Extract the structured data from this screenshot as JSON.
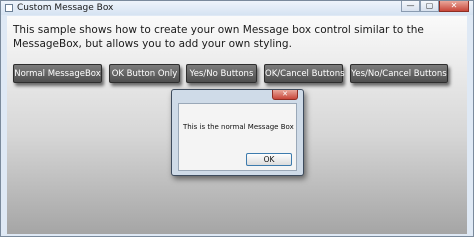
{
  "window": {
    "title": "Custom Message Box",
    "minimize_glyph": "—",
    "maximize_glyph": "▢",
    "close_glyph": "✕"
  },
  "description": "This sample shows how to create your own Message box control similar to the MessageBox, but allows you to add your own styling.",
  "buttons": [
    {
      "label": "Normal MessageBox"
    },
    {
      "label": "OK Button Only"
    },
    {
      "label": "Yes/No Buttons"
    },
    {
      "label": "OK/Cancel Buttons"
    },
    {
      "label": "Yes/No/Cancel Buttons"
    }
  ],
  "dialog": {
    "message": "This is the normal Message Box",
    "ok_label": "OK",
    "close_glyph": "✕"
  },
  "icons": {
    "app": "window-icon",
    "minimize": "minimize-icon",
    "maximize": "maximize-icon",
    "close": "close-icon"
  }
}
